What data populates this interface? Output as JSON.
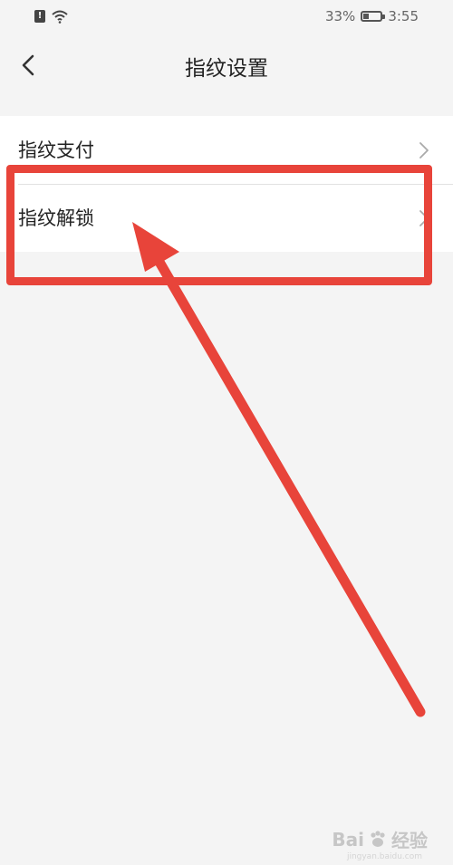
{
  "status_bar": {
    "sim_label": "!",
    "battery_percent_text": "33%",
    "battery_level": 0.33,
    "time": "3:55"
  },
  "nav": {
    "title": "指纹设置",
    "back_icon": "chevron-left-icon"
  },
  "settings": {
    "items": [
      {
        "label": "指纹支付",
        "icon": "chevron-right-icon"
      },
      {
        "label": "指纹解锁",
        "icon": "chevron-right-icon"
      }
    ]
  },
  "annotation": {
    "color": "#e8443a"
  },
  "watermark": {
    "brand": "Bai",
    "suffix": "经验",
    "url": "jingyan.baidu.com"
  }
}
